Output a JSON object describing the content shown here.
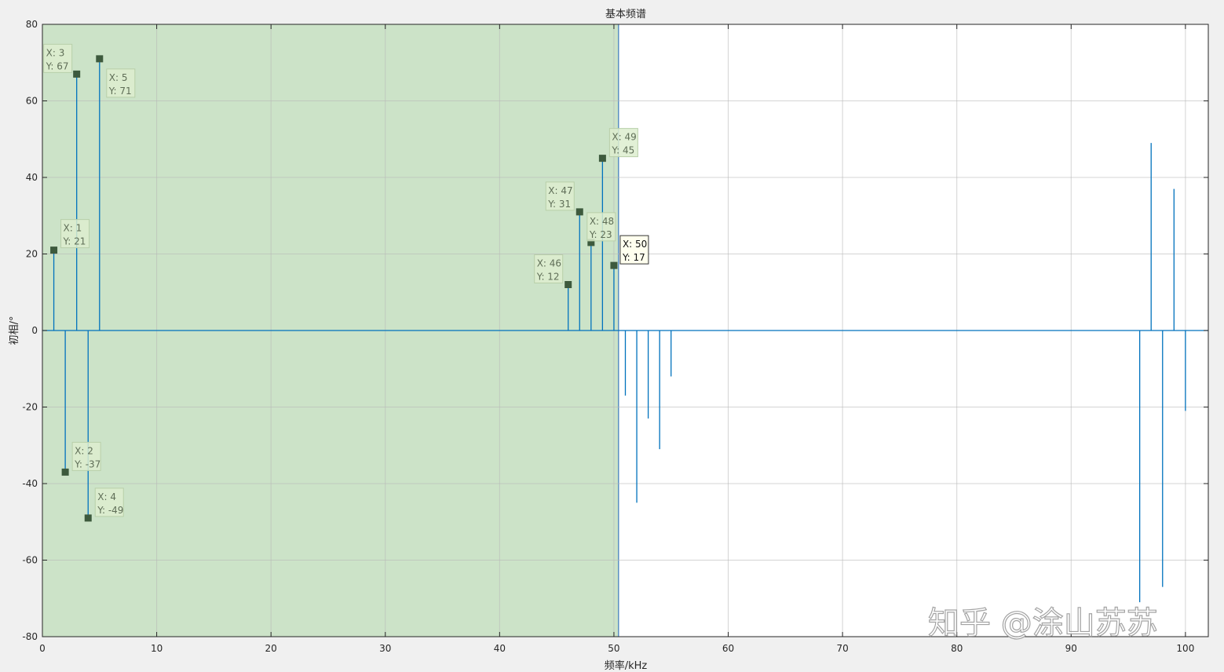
{
  "chart_data": {
    "type": "stem",
    "title": "基本频谱",
    "xlabel": "频率/kHz",
    "ylabel": "初相/°",
    "xlim": [
      0,
      102
    ],
    "ylim": [
      -80,
      80
    ],
    "xticks": [
      "0",
      "10",
      "20",
      "30",
      "40",
      "50",
      "60",
      "70",
      "80",
      "90",
      "100"
    ],
    "yticks": [
      "80",
      "60",
      "40",
      "20",
      "0",
      "-20",
      "-40",
      "-60",
      "-80"
    ],
    "grid": true,
    "series": [
      {
        "color": "#0072bd",
        "x": [
          1,
          2,
          3,
          4,
          5,
          46,
          47,
          48,
          49,
          50,
          51,
          52,
          53,
          54,
          55,
          96,
          97,
          98,
          99,
          100
        ],
        "y": [
          21,
          -37,
          67,
          -49,
          71,
          12,
          31,
          23,
          45,
          17,
          -17,
          -45,
          -23,
          -31,
          -12,
          -71,
          49,
          -67,
          37,
          -21
        ]
      }
    ],
    "highlight_region": {
      "x": [
        0,
        50.4
      ],
      "color": "#cce3c8"
    },
    "datatips": [
      {
        "x_text": "X: 3",
        "y_text": "Y: 67",
        "x": 3,
        "y": 67,
        "active": false
      },
      {
        "x_text": "X: 5",
        "y_text": "Y: 71",
        "x": 5,
        "y": 71,
        "active": false
      },
      {
        "x_text": "X: 1",
        "y_text": "Y: 21",
        "x": 1,
        "y": 21,
        "active": false
      },
      {
        "x_text": "X: 2",
        "y_text": "Y: -37",
        "x": 2,
        "y": -37,
        "active": false
      },
      {
        "x_text": "X: 4",
        "y_text": "Y: -49",
        "x": 4,
        "y": -49,
        "active": false
      },
      {
        "x_text": "X: 47",
        "y_text": "Y: 31",
        "x": 47,
        "y": 31,
        "active": false
      },
      {
        "x_text": "X: 46",
        "y_text": "Y: 12",
        "x": 46,
        "y": 12,
        "active": false
      },
      {
        "x_text": "X: 49",
        "y_text": "Y: 45",
        "x": 49,
        "y": 45,
        "active": false
      },
      {
        "x_text": "X: 48",
        "y_text": "Y: 23",
        "x": 48,
        "y": 23,
        "active": false
      },
      {
        "x_text": "X: 50",
        "y_text": "Y: 17",
        "x": 50,
        "y": 17,
        "active": true
      }
    ]
  },
  "watermark": "知乎 @涂山苏苏"
}
